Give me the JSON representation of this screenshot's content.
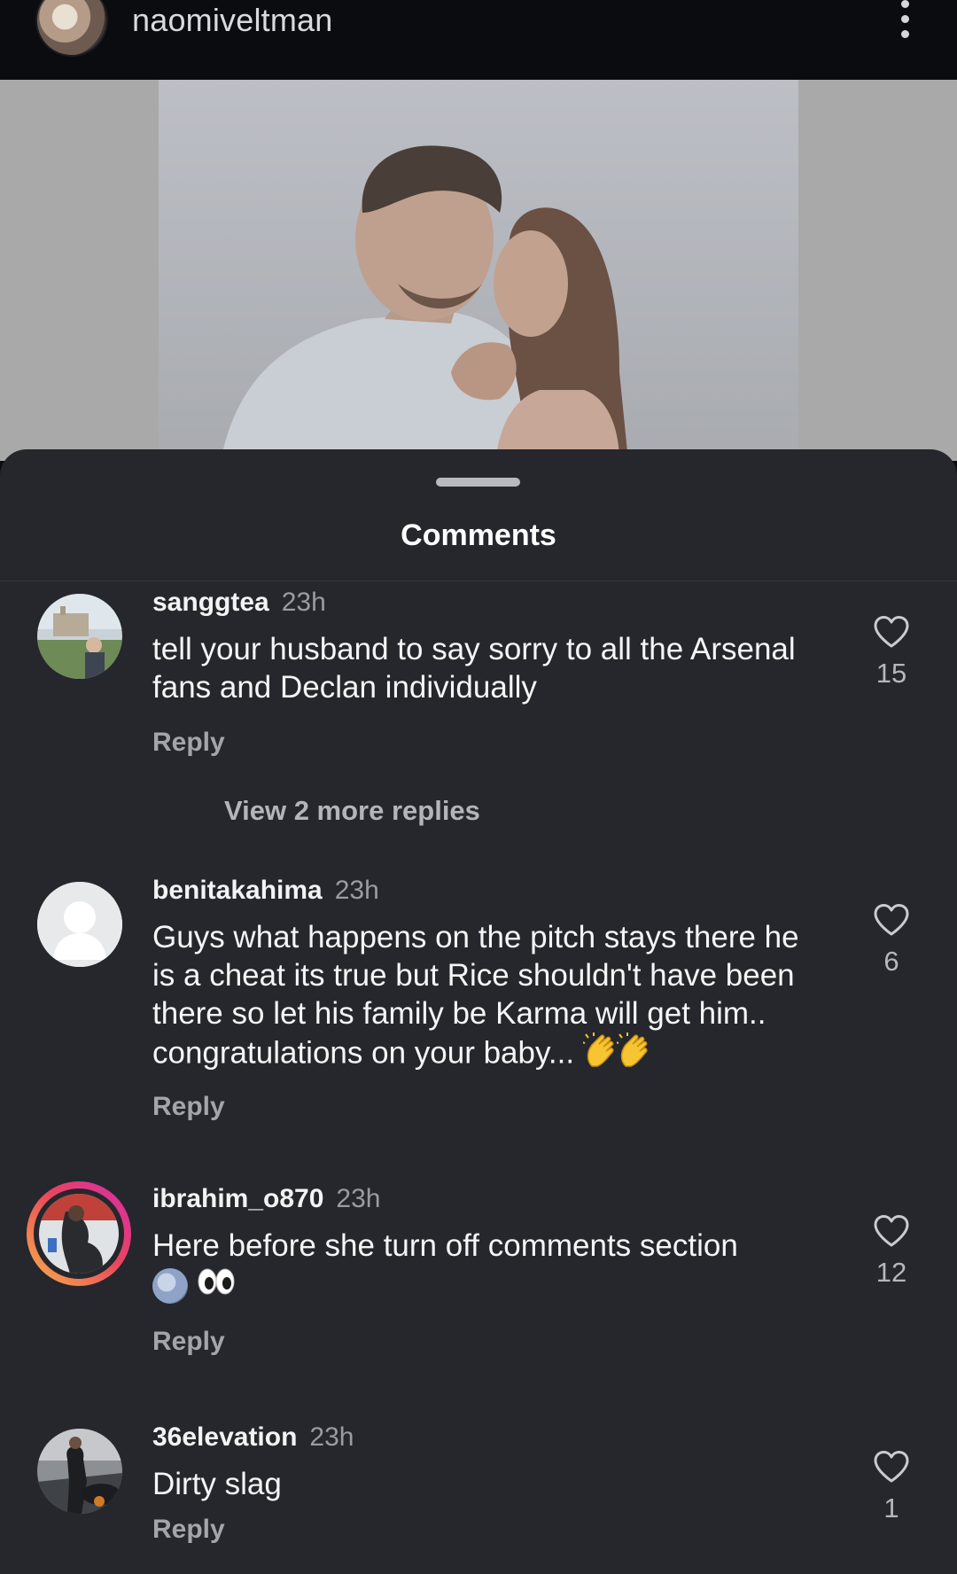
{
  "header": {
    "username": "naomiveltman"
  },
  "sheet": {
    "title": "Comments"
  },
  "comments": [
    {
      "username": "sanggtea",
      "time": "23h",
      "text": "tell your husband to say sorry to all the Arsenal fans and Declan individually",
      "reply_label": "Reply",
      "likes": "15",
      "view_more": "View 2 more replies"
    },
    {
      "username": "benitakahima",
      "time": "23h",
      "text": "Guys what happens on the pitch stays there he is a cheat its true but Rice shouldn't have been there so let his family be Karma will get him.. congratulations on your baby...",
      "emojis": [
        "clapping-hands",
        "clapping-hands"
      ],
      "reply_label": "Reply",
      "likes": "6"
    },
    {
      "username": "ibrahim_o870",
      "time": "23h",
      "text": "Here before she turn off comments section",
      "emojis": [
        "moon-face",
        "eyes"
      ],
      "reply_label": "Reply",
      "likes": "12"
    },
    {
      "username": "36elevation",
      "time": "23h",
      "text": "Dirty slag",
      "reply_label": "Reply",
      "likes": "1"
    }
  ],
  "colors": {
    "sheet_bg": "#25272c",
    "story_ring_start": "#f6b44a",
    "story_ring_end": "#d62ab0"
  }
}
